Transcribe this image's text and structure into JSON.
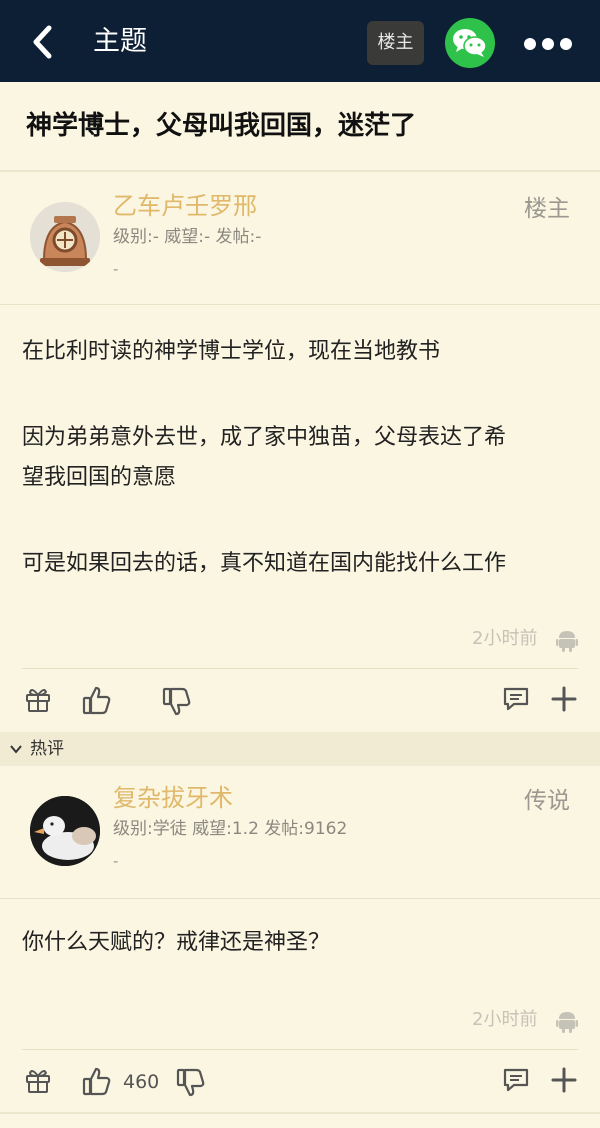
{
  "header": {
    "title": "主题",
    "op_button": "楼主",
    "share_icon": "wechat-icon",
    "more_icon": "more-dots-icon"
  },
  "thread": {
    "title": "神学博士，父母叫我回国，迷茫了"
  },
  "op_post": {
    "username": "乙车卢壬罗邢",
    "stats": "级别:- 威望:- 发帖:-",
    "sub": "-",
    "badge": "楼主",
    "paragraphs": [
      "在比利时读的神学博士学位，现在当地教书",
      "因为弟弟意外去世，成了家中独苗，父母表达了希",
      "望我回国的意愿",
      "可是如果回去的话，真不知道在国内能找什么工作"
    ],
    "time": "2小时前",
    "like_count": ""
  },
  "hot_section": {
    "label": "热评"
  },
  "reply": {
    "username": "复杂拔牙术",
    "stats": "级别:学徒 威望:1.2 发帖:9162",
    "sub": "-",
    "badge": "传说",
    "text": "你什么天赋的？戒律还是神圣？",
    "time": "2小时前",
    "like_count": "460"
  },
  "colors": {
    "topbar": "#0d1f35",
    "background": "#fbf6e2",
    "username": "#e0b86a",
    "wechat": "#2ec24a"
  }
}
